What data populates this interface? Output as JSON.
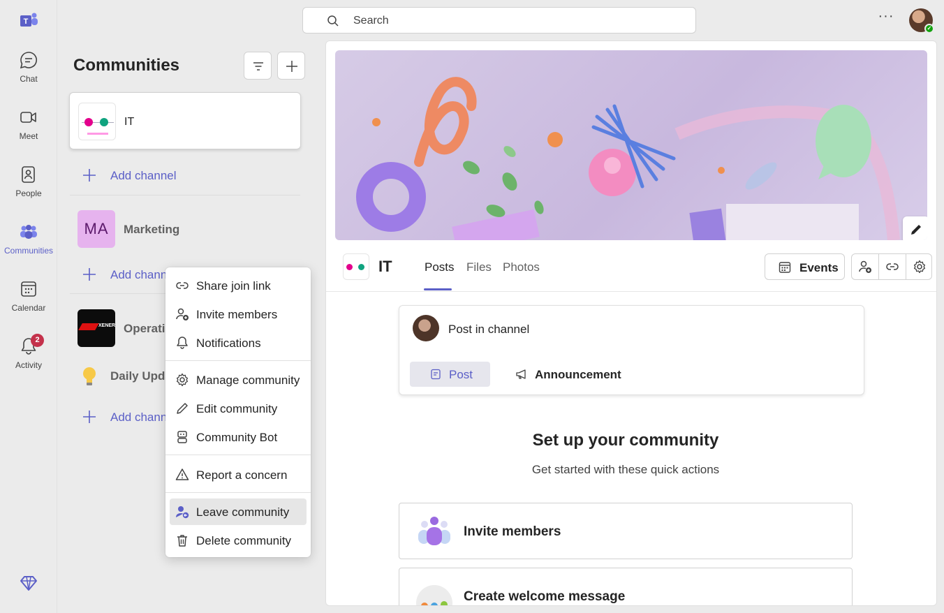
{
  "rail": {
    "items": [
      {
        "label": "Chat",
        "icon": "chat-icon"
      },
      {
        "label": "Meet",
        "icon": "video-camera-icon"
      },
      {
        "label": "People",
        "icon": "people-icon"
      },
      {
        "label": "Communities",
        "icon": "communities-icon",
        "active": true
      },
      {
        "label": "Calendar",
        "icon": "calendar-icon"
      },
      {
        "label": "Activity",
        "icon": "bell-icon",
        "badge": "2"
      }
    ],
    "accent": "#5b5fc7"
  },
  "search": {
    "placeholder": "Search"
  },
  "pane": {
    "title": "Communities",
    "selected_community": {
      "name": "IT"
    },
    "add_channel_label": "Add channel",
    "communities": [
      {
        "initials": "MA",
        "name": "Marketing"
      },
      {
        "name": "Operations",
        "visible_name": "Operati"
      },
      {
        "name": "Daily Updates",
        "visible_name": "Daily Upda"
      }
    ],
    "add_channel_truncated": "Add chann"
  },
  "menu": {
    "items": [
      {
        "label": "Share join link",
        "icon": "link-icon"
      },
      {
        "label": "Invite members",
        "icon": "person-add-icon"
      },
      {
        "label": "Notifications",
        "icon": "bell-icon"
      },
      {
        "label": "Manage community",
        "icon": "gear-icon"
      },
      {
        "label": "Edit community",
        "icon": "pencil-icon"
      },
      {
        "label": "Community Bot",
        "icon": "bot-icon"
      },
      {
        "label": "Report a concern",
        "icon": "warning-icon"
      },
      {
        "label": "Leave community",
        "icon": "person-leave-icon",
        "highlighted": true
      },
      {
        "label": "Delete community",
        "icon": "trash-icon"
      }
    ]
  },
  "main": {
    "community_name": "IT",
    "tabs": [
      {
        "label": "Posts",
        "active": true
      },
      {
        "label": "Files"
      },
      {
        "label": "Photos"
      }
    ],
    "events_label": "Events",
    "composer": {
      "placeholder": "Post in channel",
      "post_label": "Post",
      "announcement_label": "Announcement"
    },
    "setup": {
      "title": "Set up your community",
      "subtitle": "Get started with these quick actions"
    },
    "quick_actions": [
      {
        "label": "Invite members"
      },
      {
        "label": "Create welcome message"
      }
    ]
  }
}
